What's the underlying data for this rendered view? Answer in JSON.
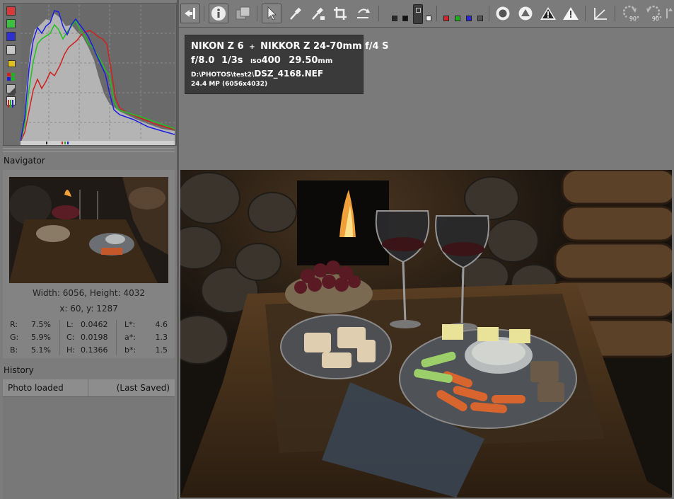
{
  "histogram": {
    "buttons": [
      {
        "name": "red-channel-toggle",
        "color": "#d83a3a"
      },
      {
        "name": "green-channel-toggle",
        "color": "#3fbf3f"
      },
      {
        "name": "blue-channel-toggle",
        "color": "#3030d0"
      },
      {
        "name": "luminance-toggle",
        "color": "#c8c8c8"
      },
      {
        "name": "chroma-toggle",
        "color": "#e0c020"
      },
      {
        "name": "raw-histogram-toggle",
        "color": "#6e6e6e"
      },
      {
        "name": "bar-display-toggle",
        "color": "#b8b8b8"
      },
      {
        "name": "histogram-mode-toggle",
        "color": "#dddddd"
      }
    ],
    "colors": {
      "red": "#d02020",
      "green": "#20c020",
      "blue": "#1d1de0",
      "fill": "#b4b4b4"
    }
  },
  "navigator": {
    "title": "Navigator",
    "dimensions": "Width: 6056, Height: 4032",
    "coords": "x: 60, y: 1287",
    "rgb": [
      {
        "label": "R:",
        "value": "7.5%"
      },
      {
        "label": "G:",
        "value": "5.9%"
      },
      {
        "label": "B:",
        "value": "5.1%"
      }
    ],
    "lch": [
      {
        "label": "L:",
        "value": "0.0462"
      },
      {
        "label": "C:",
        "value": "0.0198"
      },
      {
        "label": "H:",
        "value": "0.1366"
      }
    ],
    "lab": [
      {
        "label": "L*:",
        "value": "4.6"
      },
      {
        "label": "a*:",
        "value": "1.3"
      },
      {
        "label": "b*:",
        "value": "1.5"
      }
    ]
  },
  "history": {
    "title": "History",
    "entries": [
      {
        "action": "Photo loaded",
        "status": "(Last Saved)"
      }
    ]
  },
  "toolbar": {
    "rotate_left_label": "90°",
    "rotate_right_label": "90°",
    "accent_colors": {
      "red": "#d02828",
      "green": "#20b020",
      "blue": "#2a2ad0"
    }
  },
  "photo_info": {
    "camera": "NIKON Z 6",
    "plus": "+",
    "lens": "NIKKOR Z 24-70mm f/4 S",
    "aperture": "f/8.0",
    "shutter": "1/3s",
    "iso_label": "ISO",
    "iso_value": "400",
    "focal_value": "29.50",
    "focal_unit": "mm",
    "path": "D:\\PHOTOS\\test2\\",
    "filename": "DSZ_4168.NEF",
    "megapixels": "24.4 MP (6056x4032)"
  }
}
